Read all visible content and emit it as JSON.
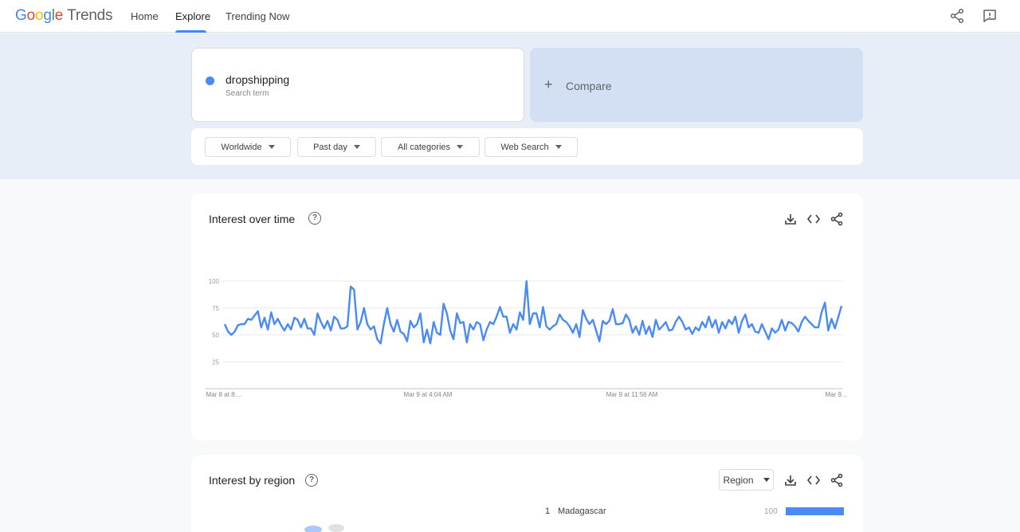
{
  "header": {
    "logo_google": "Google",
    "logo_trends": "Trends",
    "nav": [
      "Home",
      "Explore",
      "Trending Now"
    ],
    "active_nav": "Explore"
  },
  "search_term": {
    "name": "dropshipping",
    "type": "Search term",
    "color": "#4a8af4"
  },
  "compare": {
    "label": "Compare"
  },
  "filters": {
    "location": "Worldwide",
    "time": "Past day",
    "category": "All categories",
    "property": "Web Search"
  },
  "interest_over_time": {
    "title": "Interest over time",
    "help_icon": "help-circle-icon"
  },
  "chart_data": {
    "type": "line",
    "title": "",
    "xlabel": "",
    "ylabel": "",
    "ylim": [
      0,
      100
    ],
    "yticks": [
      25,
      50,
      75,
      100
    ],
    "x_tick_labels": [
      "Mar 8 at 8:...",
      "Mar 9 at 4:04 AM",
      "Mar 9 at 11:56 AM",
      "Mar 9..."
    ],
    "grid": true,
    "series": [
      {
        "color": "#4a8af4",
        "values": [
          60,
          53,
          50,
          53,
          59,
          60,
          60,
          65,
          64,
          68,
          72,
          57,
          66,
          55,
          71,
          60,
          65,
          59,
          54,
          60,
          55,
          66,
          64,
          57,
          65,
          56,
          56,
          50,
          70,
          62,
          56,
          63,
          54,
          67,
          64,
          56,
          56,
          58,
          95,
          92,
          55,
          62,
          75,
          60,
          55,
          58,
          46,
          42,
          60,
          75,
          60,
          53,
          64,
          53,
          51,
          44,
          63,
          57,
          60,
          70,
          43,
          55,
          42,
          62,
          52,
          50,
          79,
          70,
          54,
          46,
          70,
          61,
          62,
          43,
          60,
          55,
          62,
          60,
          45,
          55,
          62,
          60,
          67,
          76,
          67,
          67,
          52,
          60,
          55,
          71,
          64,
          100,
          60,
          70,
          70,
          57,
          76,
          58,
          55,
          58,
          60,
          69,
          64,
          62,
          58,
          52,
          60,
          48,
          73,
          65,
          60,
          64,
          54,
          44,
          63,
          60,
          63,
          74,
          60,
          60,
          61,
          69,
          64,
          52,
          58,
          50,
          63,
          51,
          58,
          48,
          64,
          55,
          58,
          62,
          54,
          55,
          62,
          67,
          62,
          55,
          57,
          51,
          57,
          54,
          62,
          57,
          67,
          57,
          64,
          52,
          62,
          56,
          64,
          60,
          67,
          52,
          63,
          69,
          57,
          60,
          53,
          52,
          60,
          53,
          46,
          56,
          52,
          55,
          64,
          54,
          62,
          61,
          58,
          53,
          62,
          67,
          63,
          60,
          57,
          57,
          71,
          80,
          54,
          65,
          56,
          66,
          77
        ]
      }
    ]
  },
  "interest_by_region": {
    "title": "Interest by region",
    "help_icon": "help-circle-icon",
    "select": "Region",
    "rows": [
      {
        "rank": "1",
        "name": "Madagascar",
        "value": "100",
        "level": 100
      }
    ]
  }
}
